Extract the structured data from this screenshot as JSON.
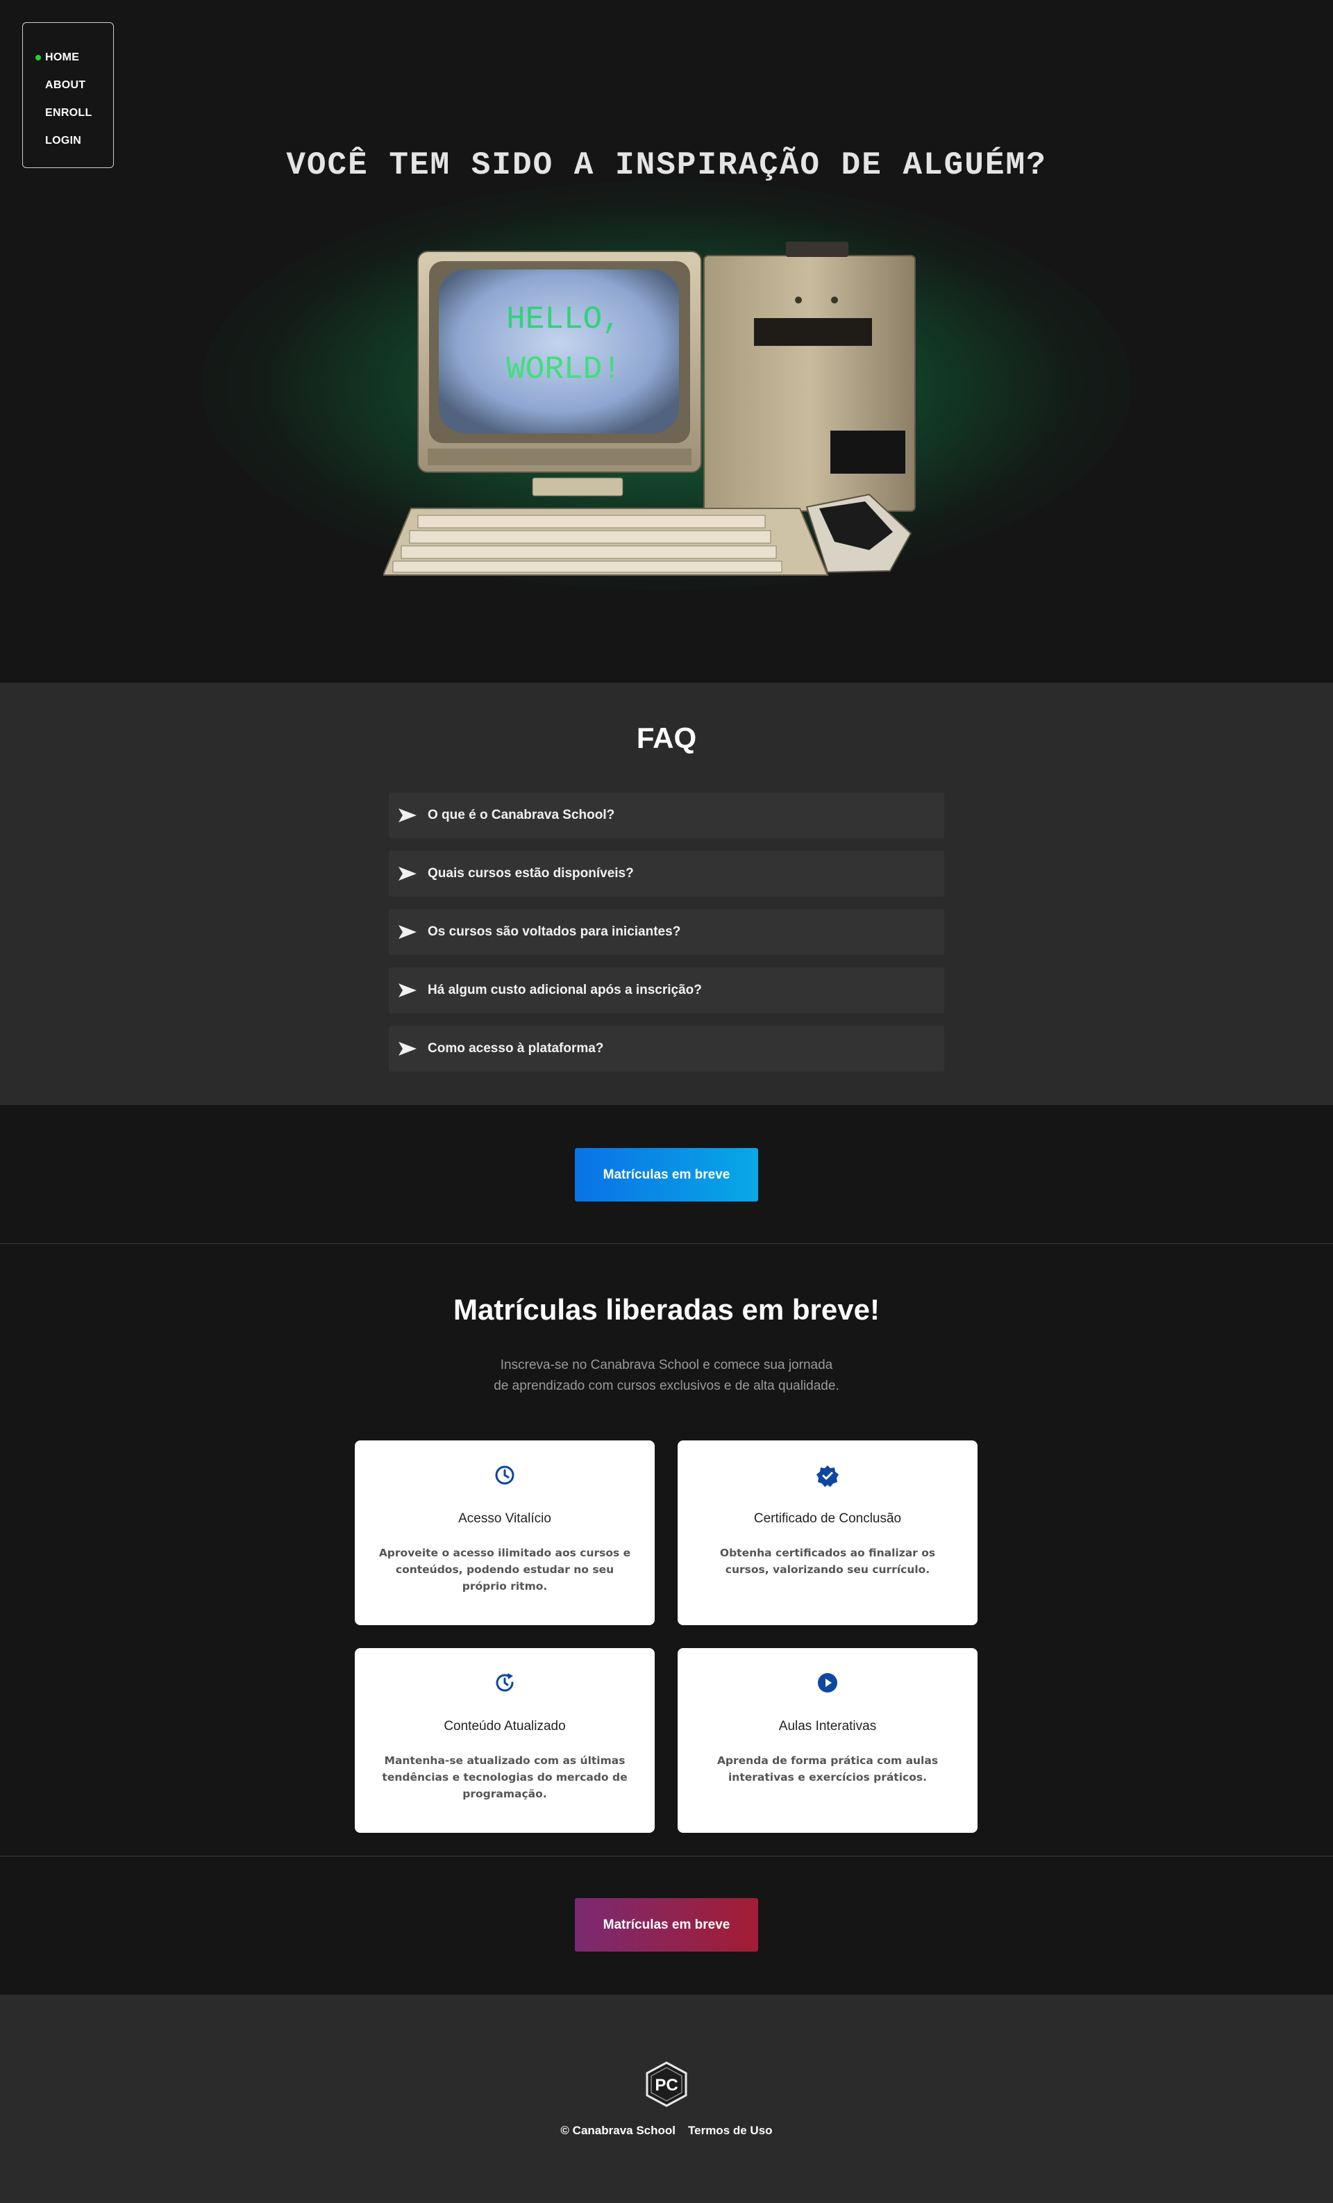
{
  "nav": {
    "items": [
      {
        "label": "HOME",
        "active": true
      },
      {
        "label": "ABOUT",
        "active": false
      },
      {
        "label": "ENROLL",
        "active": false
      },
      {
        "label": "LOGIN",
        "active": false
      }
    ],
    "active_color": "#22d33a"
  },
  "hero": {
    "title": "VOCÊ TEM SIDO A INSPIRAÇÃO DE ALGUÉM?",
    "screen_line1": "HELLO,",
    "screen_line2": "WORLD!"
  },
  "faq": {
    "title": "FAQ",
    "items": [
      "O que é o Canabrava School?",
      "Quais cursos estão disponíveis?",
      "Os cursos são voltados para iniciantes?",
      "Há algum custo adicional após a inscrição?",
      "Como acesso à plataforma?"
    ]
  },
  "cta_top": {
    "label": "Matrículas em breve"
  },
  "features": {
    "title": "Matrículas liberadas em breve!",
    "subtitle_line1": "Inscreva-se no Canabrava School e comece sua jornada",
    "subtitle_line2": "de aprendizado com cursos exclusivos e de alta qualidade.",
    "cards": [
      {
        "icon": "clock-icon",
        "title": "Acesso Vitalício",
        "text": "Aproveite o acesso ilimitado aos cursos e conteúdos, podendo estudar no seu próprio ritmo."
      },
      {
        "icon": "verified-badge-icon",
        "title": "Certificado de Conclusão",
        "text": "Obtenha certificados ao finalizar os cursos, valorizando seu currículo."
      },
      {
        "icon": "refresh-clock-icon",
        "title": "Conteúdo Atualizado",
        "text": "Mantenha-se atualizado com as últimas tendências e tecnologias do mercado de programação."
      },
      {
        "icon": "play-circle-icon",
        "title": "Aulas Interativas",
        "text": "Aprenda de forma prática com aulas interativas e exercícios práticos."
      }
    ],
    "icon_color": "#0d47a1"
  },
  "cta_bottom": {
    "label": "Matrículas em breve"
  },
  "footer": {
    "logo_text": "PC",
    "copyright": "© Canabrava School",
    "terms": "Termos de Uso"
  }
}
